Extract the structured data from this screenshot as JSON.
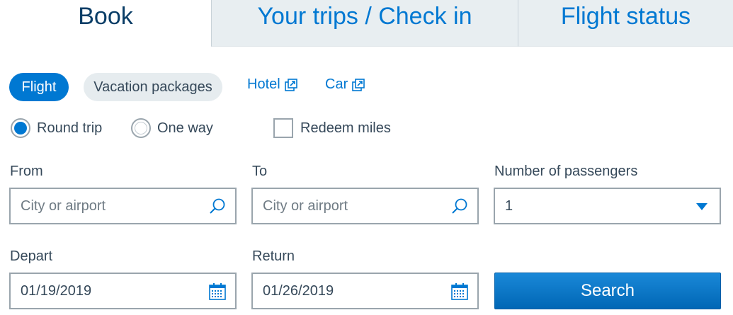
{
  "tabs": [
    {
      "label": "Book",
      "active": true
    },
    {
      "label": "Your trips / Check in",
      "active": false
    },
    {
      "label": "Flight status",
      "active": false
    }
  ],
  "modes": {
    "flight": "Flight",
    "vacation": "Vacation packages",
    "hotel": "Hotel",
    "car": "Car"
  },
  "trip_type": {
    "round_trip": "Round trip",
    "one_way": "One way",
    "selected": "round_trip",
    "redeem_miles": "Redeem miles",
    "redeem_checked": false
  },
  "fields": {
    "from_label": "From",
    "from_placeholder": "City or airport",
    "to_label": "To",
    "to_placeholder": "City or airport",
    "passengers_label": "Number of passengers",
    "passengers_value": "1",
    "depart_label": "Depart",
    "depart_value": "01/19/2019",
    "return_label": "Return",
    "return_value": "01/26/2019"
  },
  "search_label": "Search",
  "colors": {
    "accent": "#0078d2",
    "tab_inactive_bg": "#e8eef1",
    "text": "#36495a"
  },
  "icons": {
    "external": "external-link-icon",
    "search": "magnifier-icon",
    "calendar": "calendar-icon",
    "dropdown": "chevron-down-icon"
  }
}
